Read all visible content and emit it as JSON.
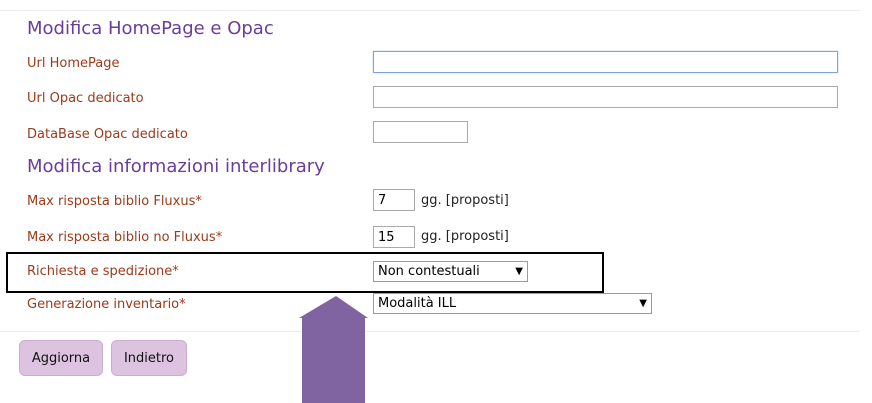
{
  "homepage_section": {
    "title": "Modifica HomePage e Opac",
    "url_homepage": {
      "label": "Url HomePage",
      "value": ""
    },
    "url_opac": {
      "label": "Url Opac dedicato",
      "value": ""
    },
    "db_opac": {
      "label": "DataBase Opac dedicato",
      "value": ""
    }
  },
  "interlibrary_section": {
    "title": "Modifica informazioni interlibrary",
    "max_fluxus": {
      "label": "Max risposta biblio Fluxus*",
      "value": "7",
      "suffix": "gg. [proposti]"
    },
    "max_no_fluxus": {
      "label": "Max risposta biblio no Fluxus*",
      "value": "15",
      "suffix": "gg. [proposti]"
    },
    "richiesta": {
      "label": "Richiesta e spedizione*",
      "selected": "Non contestuali"
    },
    "inventario": {
      "label": "Generazione inventario*",
      "selected": "Modalità ILL"
    }
  },
  "actions": {
    "update_label": "Aggiorna",
    "back_label": "Indietro"
  },
  "annotation": {
    "arrow_color": "#8064a2",
    "box_color": "#000000"
  }
}
